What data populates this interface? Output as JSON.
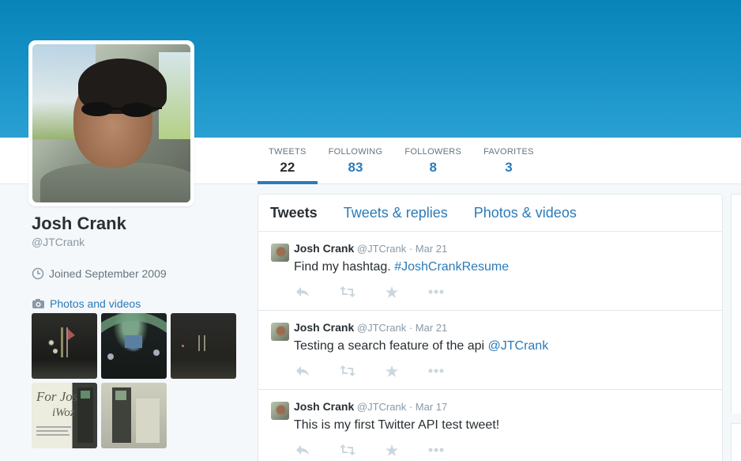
{
  "profile": {
    "name": "Josh Crank",
    "handle": "@JTCrank",
    "joined": "Joined September 2009",
    "photos_link": "Photos and videos"
  },
  "stats": [
    {
      "label": "TWEETS",
      "value": "22"
    },
    {
      "label": "FOLLOWING",
      "value": "83"
    },
    {
      "label": "FOLLOWERS",
      "value": "8"
    },
    {
      "label": "FAVORITES",
      "value": "3"
    }
  ],
  "tabs": [
    {
      "label": "Tweets"
    },
    {
      "label": "Tweets & replies"
    },
    {
      "label": "Photos & videos"
    }
  ],
  "tweets": [
    {
      "name": "Josh Crank",
      "handle": "@JTCrank",
      "sep": "·",
      "date": "Mar 21",
      "text": "Find my hashtag.",
      "link": "#JoshCrankResume"
    },
    {
      "name": "Josh Crank",
      "handle": "@JTCrank",
      "sep": "·",
      "date": "Mar 21",
      "text": "Testing a search feature of the api",
      "link": "@JTCrank"
    },
    {
      "name": "Josh Crank",
      "handle": "@JTCrank",
      "sep": "·",
      "date": "Mar 17",
      "text": "This is my first Twitter API test tweet!",
      "link": ""
    }
  ],
  "tile_text": {
    "t4a": "For Josh",
    "t4b": "iWoz"
  },
  "colors": {
    "banner": "#0884b8",
    "link": "#2b7bb9",
    "text": "#292f33",
    "muted": "#8899a6"
  }
}
